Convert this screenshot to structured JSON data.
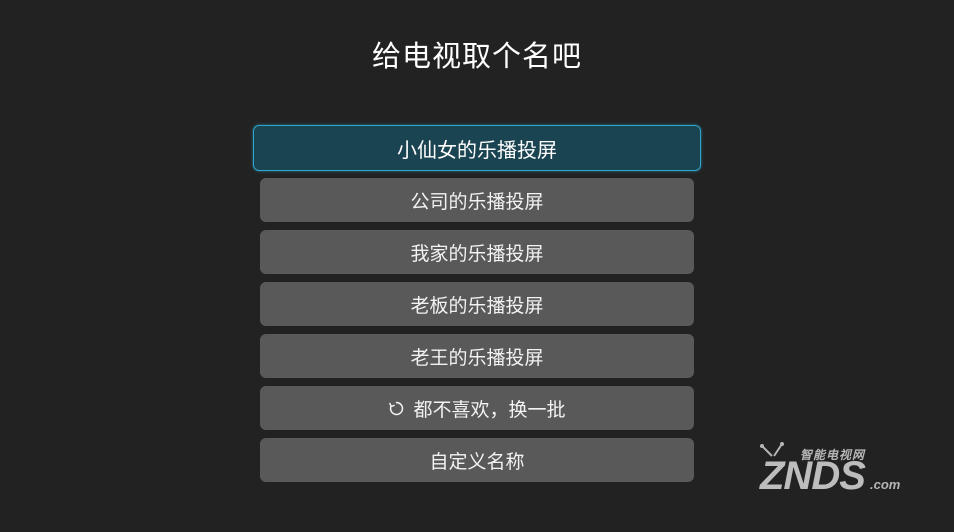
{
  "title": "给电视取个名吧",
  "options": [
    {
      "label": "小仙女的乐播投屏"
    },
    {
      "label": "公司的乐播投屏"
    },
    {
      "label": "我家的乐播投屏"
    },
    {
      "label": "老板的乐播投屏"
    },
    {
      "label": "老王的乐播投屏"
    }
  ],
  "refresh": {
    "label": "都不喜欢，换一批",
    "icon": "refresh-icon"
  },
  "custom": {
    "label": "自定义名称"
  },
  "watermark": {
    "top": "智能电视网",
    "main": "ZNDS",
    "suffix": ".com"
  },
  "colors": {
    "background": "#222222",
    "option": "#595959",
    "focused_bg": "#1b4452",
    "focused_border": "#2fa6c9"
  }
}
